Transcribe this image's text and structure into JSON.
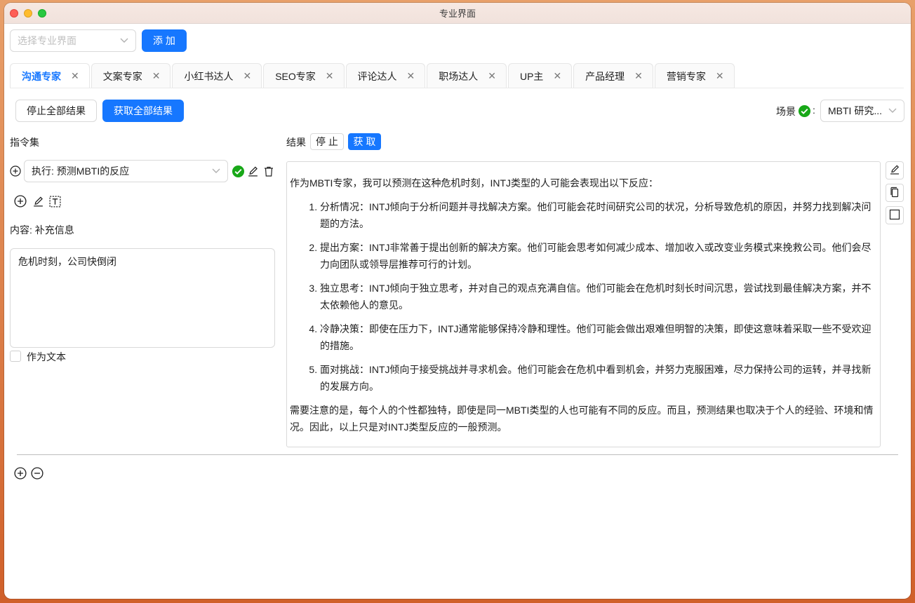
{
  "window": {
    "title": "专业界面"
  },
  "toolbar": {
    "select_placeholder": "选择专业界面",
    "add_label": "添 加"
  },
  "tabs": [
    {
      "label": "沟通专家",
      "active": true
    },
    {
      "label": "文案专家"
    },
    {
      "label": "小红书达人"
    },
    {
      "label": "SEO专家"
    },
    {
      "label": "评论达人"
    },
    {
      "label": "职场达人"
    },
    {
      "label": "UP主"
    },
    {
      "label": "产品经理"
    },
    {
      "label": "营销专家"
    }
  ],
  "actions": {
    "stop_all": "停止全部结果",
    "get_all": "获取全部结果"
  },
  "scene": {
    "label": "场景",
    "separator": ":",
    "value": "MBTI 研究..."
  },
  "instructions": {
    "title": "指令集",
    "command_value": "执行: 预测MBTI的反应",
    "content_label": "内容: 补充信息",
    "content_value": "危机时刻，公司快倒闭",
    "as_text_label": "作为文本"
  },
  "result": {
    "label": "结果",
    "stop_label": "停 止",
    "get_label": "获 取",
    "intro": "作为MBTI专家，我可以预测在这种危机时刻，INTJ类型的人可能会表现出以下反应：",
    "items": [
      "分析情况：INTJ倾向于分析问题并寻找解决方案。他们可能会花时间研究公司的状况，分析导致危机的原因，并努力找到解决问题的方法。",
      "提出方案：INTJ非常善于提出创新的解决方案。他们可能会思考如何减少成本、增加收入或改变业务模式来挽救公司。他们会尽力向团队或领导层推荐可行的计划。",
      "独立思考：INTJ倾向于独立思考，并对自己的观点充满自信。他们可能会在危机时刻长时间沉思，尝试找到最佳解决方案，并不太依赖他人的意见。",
      "冷静决策：即使在压力下，INTJ通常能够保持冷静和理性。他们可能会做出艰难但明智的决策，即使这意味着采取一些不受欢迎的措施。",
      "面对挑战：INTJ倾向于接受挑战并寻求机会。他们可能会在危机中看到机会，并努力克服困难，尽力保持公司的运转，并寻找新的发展方向。"
    ],
    "outro": "需要注意的是，每个人的个性都独特，即使是同一MBTI类型的人也可能有不同的反应。而且，预测结果也取决于个人的经验、环境和情况。因此，以上只是对INTJ类型反应的一般预测。"
  },
  "colors": {
    "primary": "#1677ff",
    "success": "#18a818"
  },
  "icons": [
    "plus-circle-icon",
    "check-circle-icon",
    "edit-icon",
    "trash-icon",
    "text-box-icon",
    "copy-icon",
    "square-icon",
    "minus-circle-icon",
    "chevron-down-icon",
    "close-icon"
  ]
}
